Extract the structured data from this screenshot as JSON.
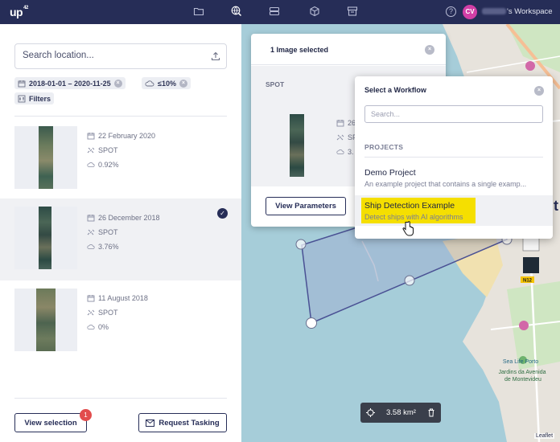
{
  "header": {
    "logo": "up",
    "logo_sup": "42",
    "avatar_initials": "CV",
    "workspace_label": "'s Workspace",
    "nav_icons": [
      "folder-icon",
      "globe-search-icon",
      "server-icon",
      "cube-icon",
      "storage-icon"
    ]
  },
  "left": {
    "search_placeholder": "Search location...",
    "date_filter": "2018-01-01 – 2020-11-25",
    "cloud_filter": "≤10%",
    "filters_label": "Filters",
    "results": [
      {
        "date": "22 February 2020",
        "sensor": "SPOT",
        "cloud": "0.92%",
        "selected": false
      },
      {
        "date": "26 December 2018",
        "sensor": "SPOT",
        "cloud": "3.76%",
        "selected": true
      },
      {
        "date": "11 August 2018",
        "sensor": "SPOT",
        "cloud": "0%",
        "selected": false
      }
    ],
    "view_selection_label": "View selection",
    "selection_count": "1",
    "request_tasking_label": "Request Tasking"
  },
  "selection_popup": {
    "title": "1 Image selected",
    "sensor": "SPOT",
    "meta_partial": [
      "26",
      "SP",
      "3."
    ],
    "view_params_label": "View Parameters"
  },
  "workflow_popup": {
    "title": "Select a Workflow",
    "search_placeholder": "Search...",
    "section_label": "PROJECTS",
    "projects": [
      {
        "name": "Demo Project",
        "description": "An example project that contains a single examp..."
      },
      {
        "name": "Ship Detection Example",
        "description": "Detect ships with AI algorithms"
      }
    ]
  },
  "map": {
    "area": "3.58 km²",
    "attribution": "Leaflet",
    "labels": {
      "sea_life": "Sea Life Porto",
      "jardins": "Jardins da Avenida\nde Montevideu",
      "road_badge": "N12",
      "partial": "t"
    }
  },
  "colors": {
    "header_bg": "#262d57",
    "accent": "#262d57",
    "highlight": "#f5df00",
    "avatar": "#d23fa6",
    "badge": "#e24d4d"
  }
}
